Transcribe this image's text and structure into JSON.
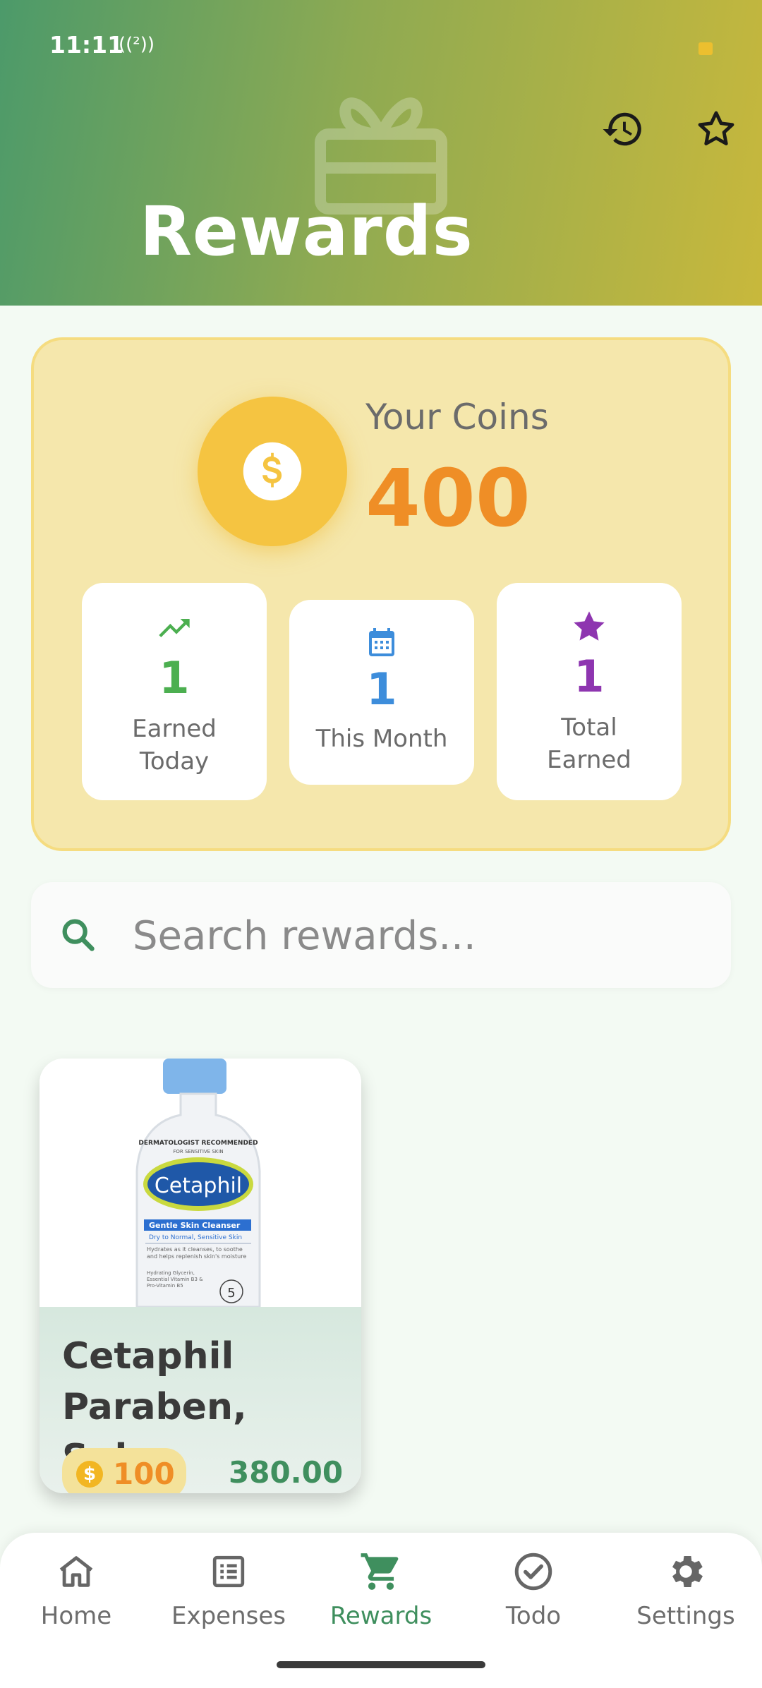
{
  "status_bar": {
    "time": "11:11",
    "signal": "((²))"
  },
  "header": {
    "title": "Rewards"
  },
  "coins": {
    "label": "Your Coins",
    "value": "400",
    "stats": [
      {
        "value": "1",
        "label": "Earned Today",
        "color": "#4caf50",
        "icon": "trending-up-icon"
      },
      {
        "value": "1",
        "label": "This Month",
        "color": "#3d8ddb",
        "icon": "calendar-icon"
      },
      {
        "value": "1",
        "label": "Total Earned",
        "color": "#8e35b0",
        "icon": "star-icon"
      }
    ]
  },
  "search": {
    "placeholder": "Search rewards..."
  },
  "products": [
    {
      "name": "Cetaphil Paraben, Sul...",
      "coin_price": "100",
      "price": "380.00",
      "image_text": {
        "badge": "DERMATOLOGIST RECOMMENDED",
        "badge_sub": "FOR SENSITIVE SKIN",
        "brand": "Cetaphil",
        "line": "Gentle Skin Cleanser",
        "type": "Dry to Normal, Sensitive Skin",
        "desc": "Hydrates as it cleanses, to soothe and helps replenish skin's moisture",
        "ingredients": "Hydrating Glycerin, Essential Vitamin B3 & Pro-Vitamin B5",
        "seal": "5"
      }
    }
  ],
  "nav": {
    "items": [
      {
        "label": "Home",
        "icon": "home-icon"
      },
      {
        "label": "Expenses",
        "icon": "list-icon"
      },
      {
        "label": "Rewards",
        "icon": "cart-icon",
        "active": true
      },
      {
        "label": "Todo",
        "icon": "check-circle-icon"
      },
      {
        "label": "Settings",
        "icon": "gear-icon"
      }
    ]
  },
  "colors": {
    "accent": "#3f8f5e",
    "coin": "#ef8e26",
    "coin_circle": "#f5c441"
  }
}
